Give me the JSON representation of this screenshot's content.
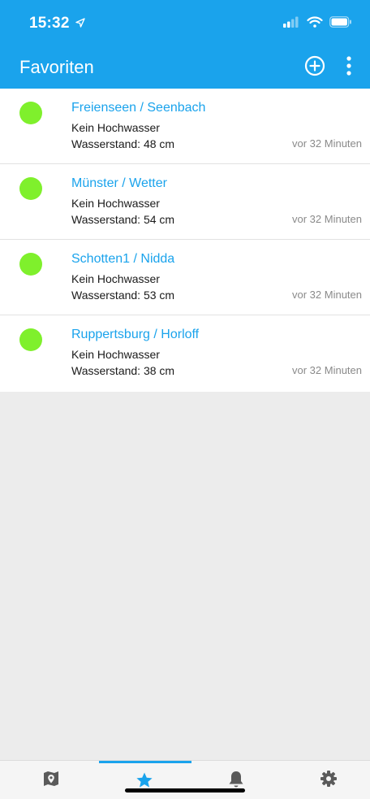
{
  "status_bar": {
    "time": "15:32",
    "icons": [
      "location-arrow-icon",
      "signal-icon",
      "wifi-icon",
      "battery-icon"
    ]
  },
  "app_bar": {
    "title": "Favoriten",
    "actions": [
      "add-circle-icon",
      "more-vertical-icon"
    ]
  },
  "stations": [
    {
      "name": "Freienseen / Seenbach",
      "status": "Kein Hochwasser",
      "level": "Wasserstand: 48 cm",
      "updated": "vor 32 Minuten"
    },
    {
      "name": "Münster / Wetter",
      "status": "Kein Hochwasser",
      "level": "Wasserstand: 54 cm",
      "updated": "vor 32 Minuten"
    },
    {
      "name": "Schotten1 / Nidda",
      "status": "Kein Hochwasser",
      "level": "Wasserstand: 53 cm",
      "updated": "vor 32 Minuten"
    },
    {
      "name": "Ruppertsburg / Horloff",
      "status": "Kein Hochwasser",
      "level": "Wasserstand: 38 cm",
      "updated": "vor 32 Minuten"
    }
  ],
  "tabs": [
    {
      "icon": "map-pin-icon",
      "active": false
    },
    {
      "icon": "star-icon",
      "active": true
    },
    {
      "icon": "bell-icon",
      "active": false
    },
    {
      "icon": "gear-icon",
      "active": false
    }
  ],
  "colors": {
    "accent": "#1aa3ec",
    "status_ok": "#7ff02c",
    "background": "#ececec",
    "tab_inactive": "#555555"
  }
}
